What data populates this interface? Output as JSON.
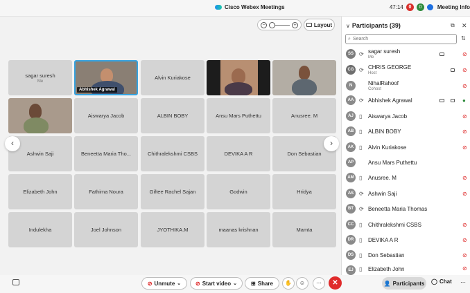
{
  "titlebar": {
    "app_title": "Cisco Webex Meetings",
    "timer": "47:14",
    "badge_red": "0",
    "badge_green": "0",
    "meeting_info": "Meeting Info"
  },
  "controls": {
    "layout_label": "Layout"
  },
  "grid": {
    "row1": [
      {
        "name": "sagar suresh",
        "sub": "Me"
      },
      {
        "name": "Abhishek Agrawal"
      },
      {
        "name": "Alvin Kuriakose"
      },
      {
        "name": ""
      },
      {
        "name": ""
      }
    ],
    "row2": [
      "",
      "Aiswarya Jacob",
      "ALBIN BOBY",
      "Ansu Mars Puthettu",
      "Anusree. M"
    ],
    "row3": [
      "Ashwin Saji",
      "Beneetta Maria Tho...",
      "Chithralekshmi CSBS",
      "DEVIKA A R",
      "Don Sebastian"
    ],
    "row4": [
      "Elizabeth John",
      "Fathima Noura",
      "Giftee Rachel Sajan",
      "Godwin",
      "Hridya"
    ],
    "row5": [
      "Indulekha",
      "Joel Johnson",
      "JYOTHIKA.M",
      "maanas krishnan",
      "Mamta"
    ]
  },
  "panel": {
    "title": "Participants (39)",
    "search_placeholder": "Search",
    "participants": [
      {
        "initials": "SS",
        "name": "sagar suresh",
        "role": "Me"
      },
      {
        "initials": "CG",
        "name": "CHRIS GEORGE",
        "role": "Host"
      },
      {
        "initials": "N",
        "name": "NihalRahoof",
        "role": "Cohost"
      },
      {
        "initials": "AA",
        "name": "Abhishek Agrawal",
        "role": ""
      },
      {
        "initials": "AJ",
        "name": "Aiswarya Jacob",
        "role": ""
      },
      {
        "initials": "AB",
        "name": "ALBIN BOBY",
        "role": ""
      },
      {
        "initials": "AK",
        "name": "Alvin Kuriakose",
        "role": ""
      },
      {
        "initials": "AP",
        "name": "Ansu Mars Puthettu",
        "role": ""
      },
      {
        "initials": "AM",
        "name": "Anusree. M",
        "role": ""
      },
      {
        "initials": "AS",
        "name": "Ashwin Saji",
        "role": ""
      },
      {
        "initials": "BT",
        "name": "Beneetta Maria Thomas",
        "role": ""
      },
      {
        "initials": "CC",
        "name": "Chithralekshmi CSBS",
        "role": ""
      },
      {
        "initials": "DR",
        "name": "DEVIKA A R",
        "role": ""
      },
      {
        "initials": "DS",
        "name": "Don Sebastian",
        "role": ""
      },
      {
        "initials": "EJ",
        "name": "Elizabeth John",
        "role": ""
      }
    ]
  },
  "bottombar": {
    "unmute_label": "Unmute",
    "start_video_label": "Start video",
    "share_label": "Share",
    "participants_label": "Participants",
    "chat_label": "Chat"
  }
}
